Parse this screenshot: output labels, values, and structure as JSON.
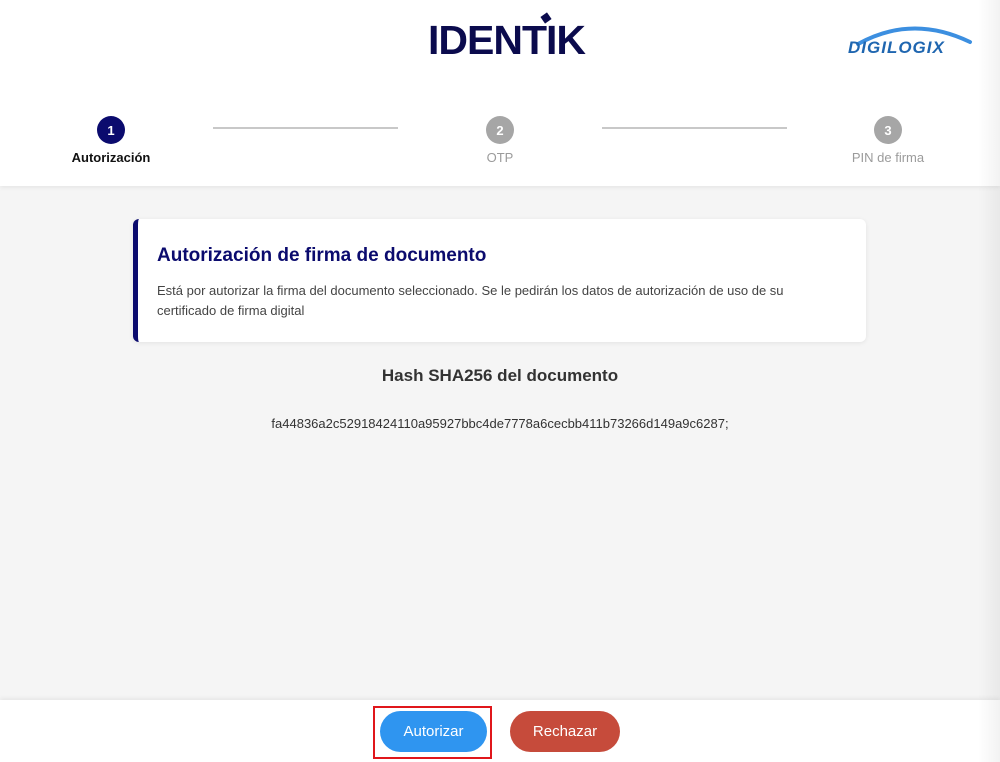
{
  "header": {
    "brand_logo": "IDENTIK",
    "partner_logo": "DIGILOGIX"
  },
  "steps": [
    {
      "number": "1",
      "label": "Autorización",
      "state": "active"
    },
    {
      "number": "2",
      "label": "OTP",
      "state": "inactive"
    },
    {
      "number": "3",
      "label": "PIN de firma",
      "state": "inactive"
    }
  ],
  "card": {
    "title": "Autorización de firma de documento",
    "body": "Está por autorizar la firma del documento seleccionado. Se le pedirán los datos de autorización de uso de su certificado de firma digital"
  },
  "hash": {
    "title": "Hash SHA256 del documento",
    "value": "fa44836a2c52918424110a95927bbc4de7778a6cecbb411b73266d149a9c6287;"
  },
  "actions": {
    "authorize_label": "Autorizar",
    "reject_label": "Rechazar"
  },
  "colors": {
    "primary": "#0b0b6e",
    "authorize": "#2f95f0",
    "reject": "#c64b3b",
    "highlight": "#e0161b"
  }
}
